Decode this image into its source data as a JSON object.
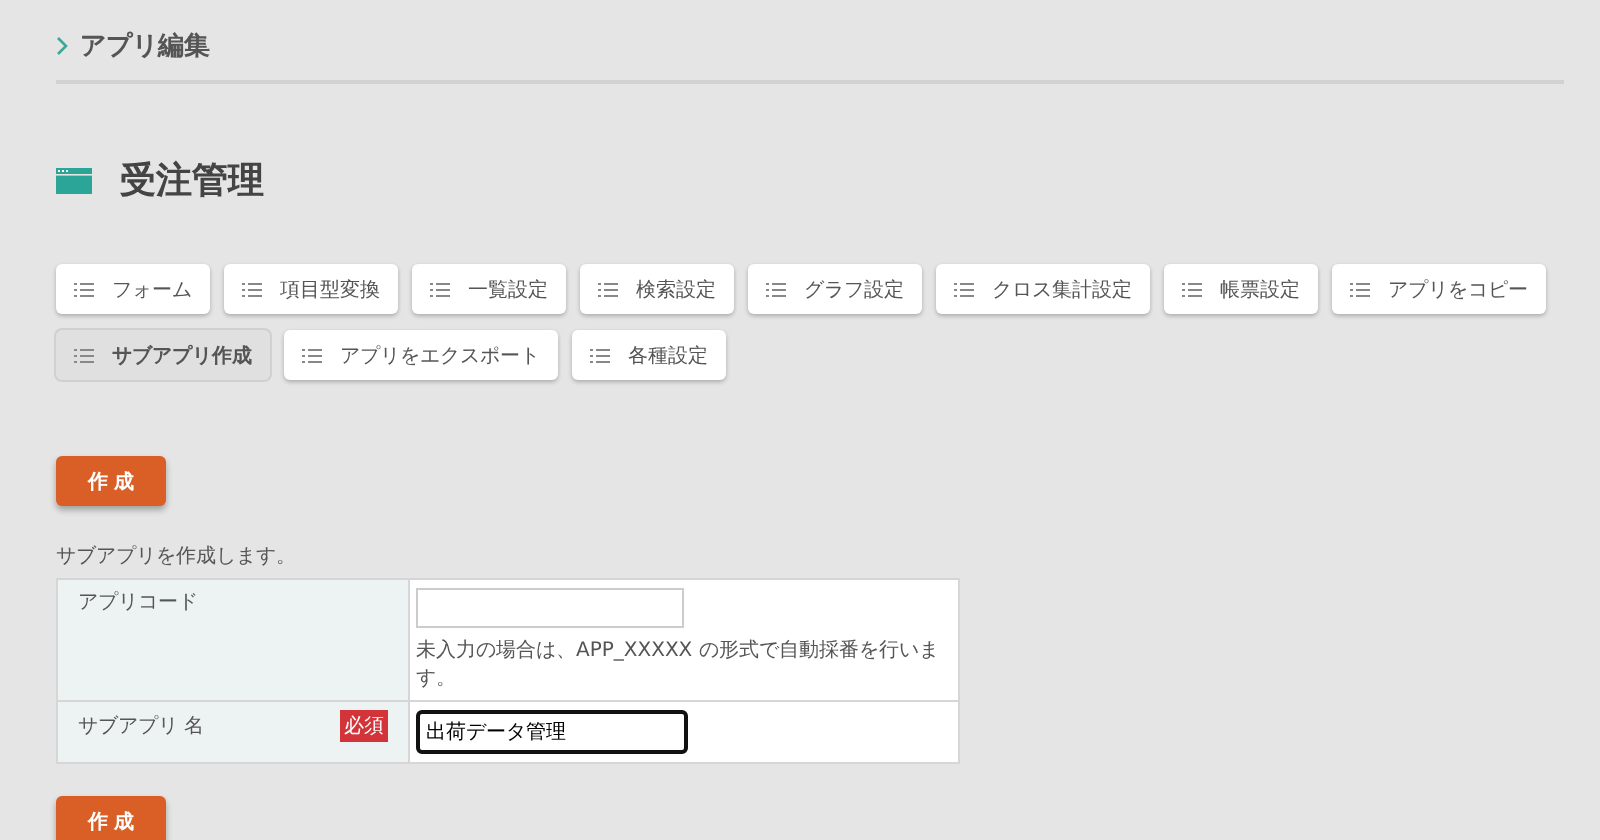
{
  "breadcrumb": {
    "label": "アプリ編集"
  },
  "title": "受注管理",
  "tabs": [
    {
      "label": "フォーム",
      "selected": false
    },
    {
      "label": "項目型変換",
      "selected": false
    },
    {
      "label": "一覧設定",
      "selected": false
    },
    {
      "label": "検索設定",
      "selected": false
    },
    {
      "label": "グラフ設定",
      "selected": false
    },
    {
      "label": "クロス集計設定",
      "selected": false
    },
    {
      "label": "帳票設定",
      "selected": false
    },
    {
      "label": "アプリをコピー",
      "selected": false
    },
    {
      "label": "サブアプリ作成",
      "selected": true
    },
    {
      "label": "アプリをエクスポート",
      "selected": false
    },
    {
      "label": "各種設定",
      "selected": false
    }
  ],
  "create_button_top": "作 成",
  "description": "サブアプリを作成します。",
  "form_rows": [
    {
      "label": "アプリコード",
      "focused": false,
      "note": "未入力の場合は、APP_XXXXX の形式で自動採番を行います。"
    },
    {
      "label": "サブアプリ 名",
      "required_badge": "必須",
      "value": "出荷データ管理",
      "focused": true
    }
  ],
  "create_button_bottom": "作 成"
}
